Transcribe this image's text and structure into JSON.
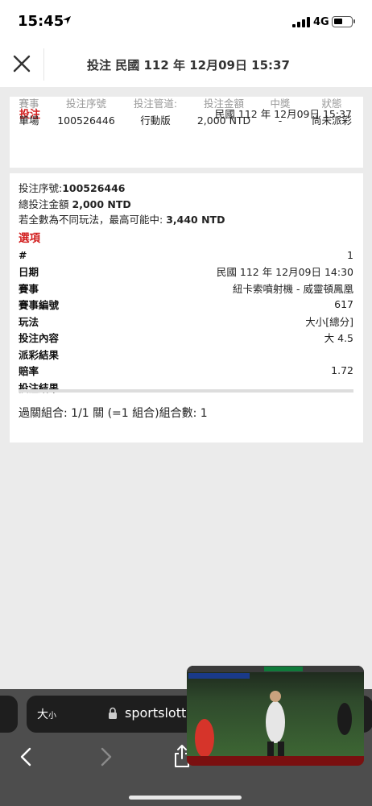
{
  "status_bar": {
    "time": "15:45",
    "network": "4G"
  },
  "header": {
    "title": "投注 民國 112 年 12月09日 15:37",
    "close_icon": "close-icon"
  },
  "bet_summary": {
    "title": "投注",
    "date": "民國 112 年 12月09日 15:37",
    "columns": [
      {
        "header": "賽事",
        "value": "單場"
      },
      {
        "header": "投注序號",
        "value": "100526446"
      },
      {
        "header": "投注管道:",
        "value": "行動版"
      },
      {
        "header": "投注金額",
        "value": "2,000 NTD"
      },
      {
        "header": "中獎",
        "value": "-"
      },
      {
        "header": "狀態",
        "value": "尚未派彩"
      }
    ]
  },
  "bet_detail": {
    "serial_label": "投注序號:",
    "serial_value": "100526446",
    "total_label": "總投注金額",
    "total_value": "2,000 NTD",
    "max_label": "若全數為不同玩法，最高可能中:",
    "max_value": "3,440 NTD",
    "section_title": "選項",
    "rows": [
      {
        "key": "#",
        "value": "1"
      },
      {
        "key": "日期",
        "value": "民國 112 年 12月09日 14:30"
      },
      {
        "key": "賽事",
        "value": "紐卡索噴射機 - 威靈頓鳳凰"
      },
      {
        "key": "賽事編號",
        "value": "617"
      },
      {
        "key": "玩法",
        "value": "大小[總分]"
      },
      {
        "key": "投注內容",
        "value": "大 4.5"
      },
      {
        "key": "派彩結果",
        "value": ""
      },
      {
        "key": "賠率",
        "value": "1.72"
      },
      {
        "key": "投注結果",
        "value": ""
      }
    ],
    "summary": "過關組合: 1/1 關 (=1 組合)組合數: 1"
  },
  "browser": {
    "aa_label": "大",
    "aa_small": "小",
    "url": "sportslott"
  },
  "pip": {
    "description": "soccer-video-thumbnail"
  }
}
